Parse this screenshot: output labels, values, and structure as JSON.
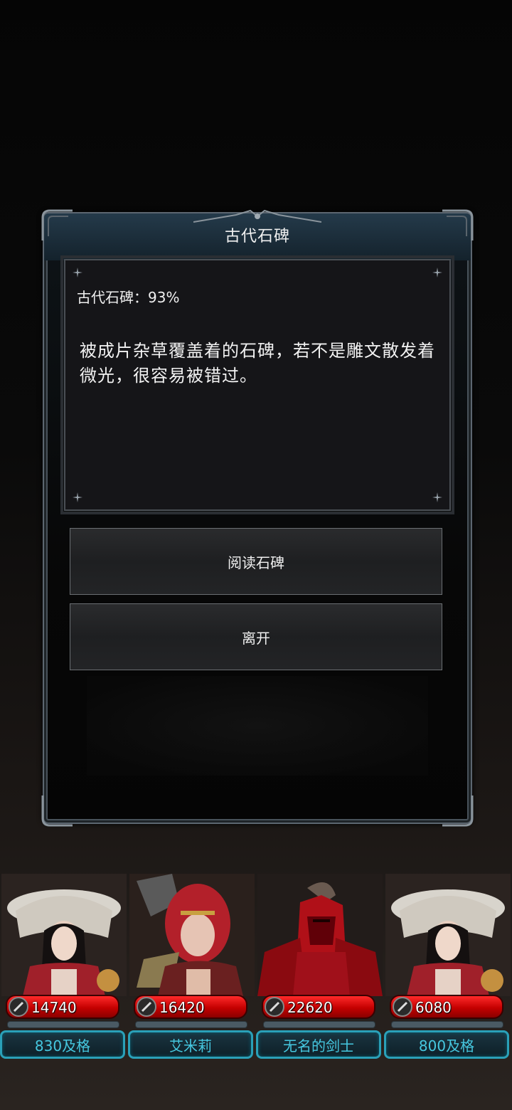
{
  "dialog": {
    "title": "古代石碑",
    "progress_text": "古代石碑：93%",
    "description": "被成片杂草覆盖着的石碑，若不是雕文散发着微光，很容易被错过。",
    "options": [
      {
        "label": "阅读石碑"
      },
      {
        "label": "离开"
      }
    ]
  },
  "party": [
    {
      "hp": "14740",
      "name": "830及格",
      "portrait": "white-hat-swordswoman"
    },
    {
      "hp": "16420",
      "name": "艾米莉",
      "portrait": "red-haired-axe-warrior"
    },
    {
      "hp": "22620",
      "name": "无名的剑士",
      "portrait": "red-armored-knight"
    },
    {
      "hp": "6080",
      "name": "800及格",
      "portrait": "white-hat-swordswoman"
    }
  ],
  "colors": {
    "hp_bar": "#d00000",
    "name_plate_border": "#2aa0b8",
    "name_text": "#46c8e0"
  }
}
